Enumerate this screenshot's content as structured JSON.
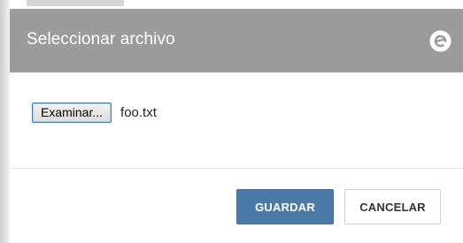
{
  "dialog": {
    "title": "Seleccionar archivo",
    "logo_icon": "app-logo-icon"
  },
  "file_input": {
    "button_label": "Examinar...",
    "file_name": "foo.txt"
  },
  "footer": {
    "save_label": "GUARDAR",
    "cancel_label": "CANCELAR"
  },
  "colors": {
    "header_bg": "#9b9b9b",
    "primary_button": "#4a7aa8",
    "title_text": "#ffffff"
  }
}
